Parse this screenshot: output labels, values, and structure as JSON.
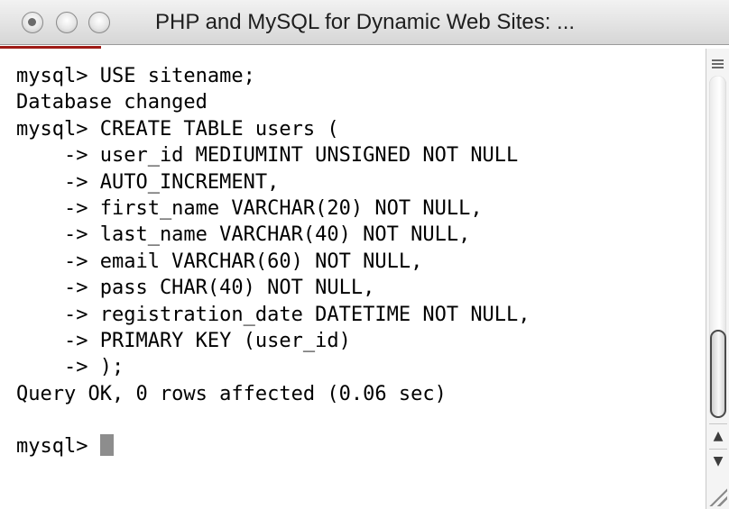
{
  "window": {
    "title": "PHP and MySQL for Dynamic Web Sites: ..."
  },
  "terminal": {
    "lines": [
      "mysql> USE sitename;",
      "Database changed",
      "mysql> CREATE TABLE users (",
      "    -> user_id MEDIUMINT UNSIGNED NOT NULL",
      "    -> AUTO_INCREMENT,",
      "    -> first_name VARCHAR(20) NOT NULL,",
      "    -> last_name VARCHAR(40) NOT NULL,",
      "    -> email VARCHAR(60) NOT NULL,",
      "    -> pass CHAR(40) NOT NULL,",
      "    -> registration_date DATETIME NOT NULL,",
      "    -> PRIMARY KEY (user_id)",
      "    -> );",
      "Query OK, 0 rows affected (0.06 sec)",
      "",
      "mysql> "
    ]
  },
  "scrollbar": {
    "up_arrow": "▲",
    "down_arrow": "▼"
  },
  "colors": {
    "title_accent": "#9e1b16",
    "cursor": "#8d8d8d",
    "text": "#000000"
  },
  "icons": [
    "close-button-icon",
    "minimize-button-icon",
    "zoom-button-icon",
    "split-pane-icon",
    "resize-grip-icon"
  ]
}
